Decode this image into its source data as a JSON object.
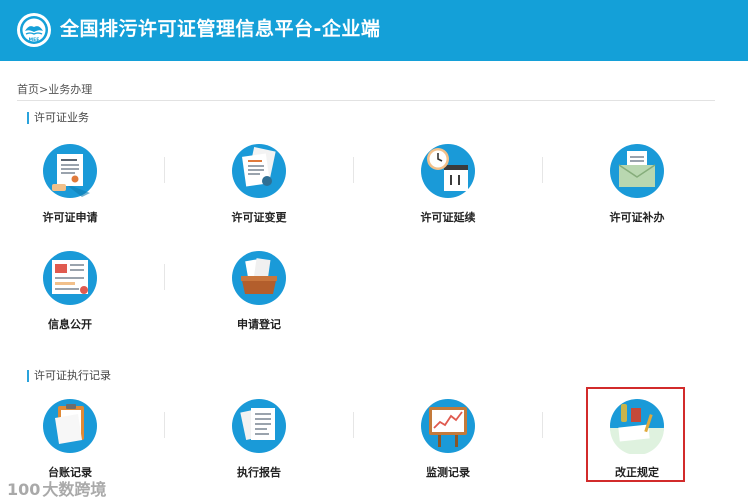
{
  "header": {
    "title": "全国排污许可证管理信息平台-企业端",
    "logo_icon": "ministry-emblem-icon",
    "logo_text": "MEE"
  },
  "breadcrumb": {
    "home": "首页",
    "separator": ">",
    "current": "业务办理"
  },
  "sections": [
    {
      "title": "许可证业务",
      "tiles": [
        {
          "label": "许可证申请",
          "icon": "application-document-icon"
        },
        {
          "label": "许可证变更",
          "icon": "change-documents-icon"
        },
        {
          "label": "许可证延续",
          "icon": "clock-calendar-icon"
        },
        {
          "label": "许可证补办",
          "icon": "envelope-icon"
        },
        {
          "label": "信息公开",
          "icon": "info-board-icon"
        },
        {
          "label": "申请登记",
          "icon": "file-box-icon"
        }
      ]
    },
    {
      "title": "许可证执行记录",
      "tiles": [
        {
          "label": "台账记录",
          "icon": "clipboard-icon"
        },
        {
          "label": "执行报告",
          "icon": "report-documents-icon"
        },
        {
          "label": "监测记录",
          "icon": "monitoring-chart-icon"
        },
        {
          "label": "改正规定",
          "icon": "correction-desk-icon"
        }
      ]
    }
  ],
  "watermark": {
    "logo": "100",
    "text": "大数跨境"
  },
  "colors": {
    "header": "#14a0d8",
    "icon_circle": "#1a9ad8",
    "highlight": "#d22b2b"
  }
}
